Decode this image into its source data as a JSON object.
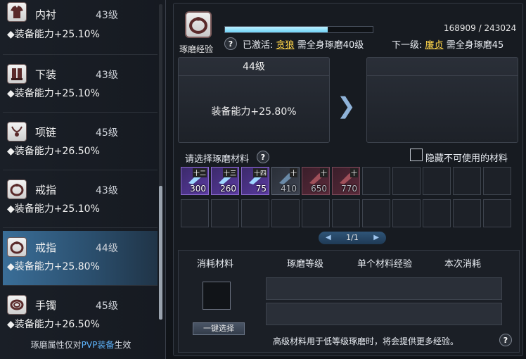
{
  "left_panel": {
    "items": [
      {
        "name": "内衬",
        "level": "43级",
        "stat": "装备能力+25.10%",
        "icon": "shirt-icon",
        "selected": false
      },
      {
        "name": "下装",
        "level": "43级",
        "stat": "装备能力+25.10%",
        "icon": "boots-icon",
        "selected": false
      },
      {
        "name": "项链",
        "level": "45级",
        "stat": "装备能力+26.50%",
        "icon": "necklace-icon",
        "selected": false
      },
      {
        "name": "戒指",
        "level": "43级",
        "stat": "装备能力+25.10%",
        "icon": "ring-icon",
        "selected": false
      },
      {
        "name": "戒指",
        "level": "44级",
        "stat": "装备能力+25.80%",
        "icon": "ring-icon",
        "selected": true
      },
      {
        "name": "手镯",
        "level": "45级",
        "stat": "装备能力+26.50%",
        "icon": "bracelet-icon",
        "selected": false
      }
    ],
    "note_prefix": "琢磨属性仅对",
    "note_highlight": "PVP装备",
    "note_suffix": "生效"
  },
  "header": {
    "caption": "琢磨经验",
    "exp_text": "168909 / 243024",
    "exp_fraction": 0.695,
    "activated_label": "已激活:",
    "activated_link": "贪狼",
    "activated_desc": "需全身琢磨40级",
    "next_label": "下一级:",
    "next_link": "廉贞",
    "next_desc": "需全身琢磨45"
  },
  "current": {
    "level": "44级",
    "stat": "装备能力+25.80%"
  },
  "materials": {
    "label": "请选择琢磨材料",
    "hide_label": "隐藏不可使用的材料",
    "items": [
      {
        "count": "300",
        "tag": "十二",
        "style": "item"
      },
      {
        "count": "260",
        "tag": "十三",
        "style": "item"
      },
      {
        "count": "75",
        "tag": "十四",
        "style": "item"
      },
      {
        "count": "410",
        "tag": "十",
        "style": "gray"
      },
      {
        "count": "650",
        "tag": "十",
        "style": "red"
      },
      {
        "count": "770",
        "tag": "十",
        "style": "red"
      }
    ],
    "pager": "1/1"
  },
  "consume": {
    "col1": "消耗材料",
    "col2": "琢磨等级",
    "col3": "单个材料经验",
    "col4": "本次消耗",
    "one_key": "一键选择",
    "hint": "高级材料用于低等级琢磨时，将会提供更多经验。"
  },
  "help_glyph": "?",
  "colors": {
    "accent": "#ffd54a",
    "exp_bar": "#6fd3f7",
    "selected_bg": "#3a6e98",
    "pvp": "#5fb6ff"
  }
}
